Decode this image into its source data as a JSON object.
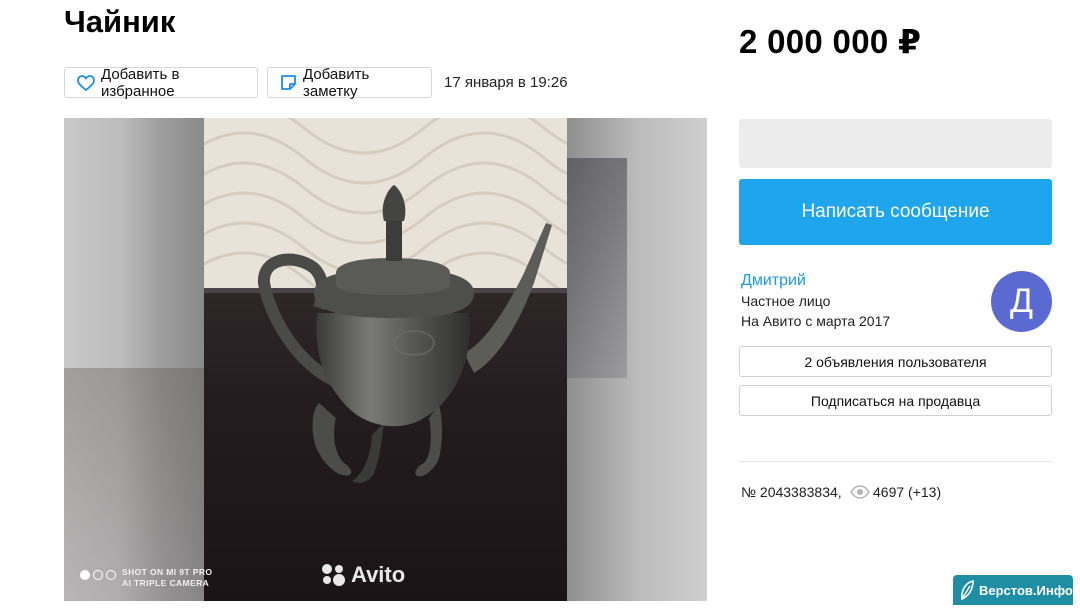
{
  "listing": {
    "title": "Чайник",
    "price": "2 000 000 ₽",
    "favorite_label": "Добавить в избранное",
    "note_label": "Добавить заметку",
    "date": "17 января в 19:26"
  },
  "gallery": {
    "photo_count": 3,
    "active_index": 0,
    "camera_line1": "SHOT ON MI 9T PRO",
    "camera_line2": "AI TRIPLE CAMERA",
    "watermark": "Avito"
  },
  "contact": {
    "message_label": "Написать сообщение"
  },
  "seller": {
    "name": "Дмитрий",
    "type": "Частное лицо",
    "since": "На Авито с марта 2017",
    "avatar_letter": "Д",
    "ads_label": "2 объявления пользователя",
    "subscribe_label": "Подписаться на продавца"
  },
  "stats": {
    "item_number": "№ 2043383834,",
    "views": "4697 (+13)"
  },
  "site_watermark": {
    "text": "Верстов.Инфо"
  },
  "colors": {
    "accent": "#1fa5ec",
    "link": "#1a9ae8",
    "avatar": "#5b6ad0",
    "watermark_bg": "#1f8ea5"
  },
  "icons": [
    "heart-icon",
    "note-icon",
    "eye-icon",
    "avito-logo-icon",
    "leaf-icon"
  ]
}
